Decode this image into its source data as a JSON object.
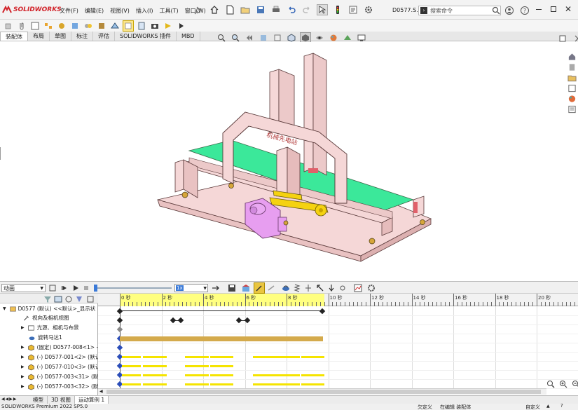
{
  "app": {
    "logo_brand": "SOLIDWORKS",
    "doc_name": "D0577.S...",
    "search_placeholder": "搜索命令"
  },
  "menu": [
    "文件(F)",
    "编辑(E)",
    "视图(V)",
    "插入(I)",
    "工具(T)",
    "窗口(W)"
  ],
  "cmd_tabs": [
    "装配体",
    "布局",
    "草图",
    "标注",
    "评估",
    "SOLIDWORKS 插件",
    "MBD"
  ],
  "model": {
    "sign_text": "机械先电站"
  },
  "motion": {
    "study_type": "动画",
    "speed": "1x"
  },
  "timeline": {
    "ticks": [
      "0 秒",
      "2 秒",
      "4 秒",
      "6 秒",
      "8 秒",
      "10 秒",
      "12 秒",
      "14 秒",
      "16 秒",
      "18 秒",
      "20 秒"
    ]
  },
  "tree": [
    {
      "label": "D0577 (默认) <<默认>_显示状"
    },
    {
      "label": "视向及相机视图"
    },
    {
      "label": "光源、相机与布景"
    },
    {
      "label": "旋转马达1"
    },
    {
      "label": "(固定) D0577-008<1> ->"
    },
    {
      "label": "(-) D0577-001<2> (默认)"
    },
    {
      "label": "(-) D0577-010<3> (默认)"
    },
    {
      "label": "(-) D0577-003<31> (默认"
    },
    {
      "label": "(-) D0577-003<32> (默认"
    }
  ],
  "bottom_tabs": [
    "模型",
    "3D 视图",
    "运动算例 1"
  ],
  "status": {
    "product": "SOLIDWORKS Premium 2022 SP5.0",
    "underdefined": "欠定义",
    "editing": "在编辑 装配体",
    "custom": "自定义"
  },
  "colors": {
    "brand_red": "#d2232a",
    "timeline_yellow": "#ffff80",
    "motor_bar": "#d4aa4c",
    "key_bar": "#f5e400",
    "model_pink": "#f5d7d7",
    "model_green": "#3be89a",
    "cylinder_violet": "#e79ef0"
  }
}
